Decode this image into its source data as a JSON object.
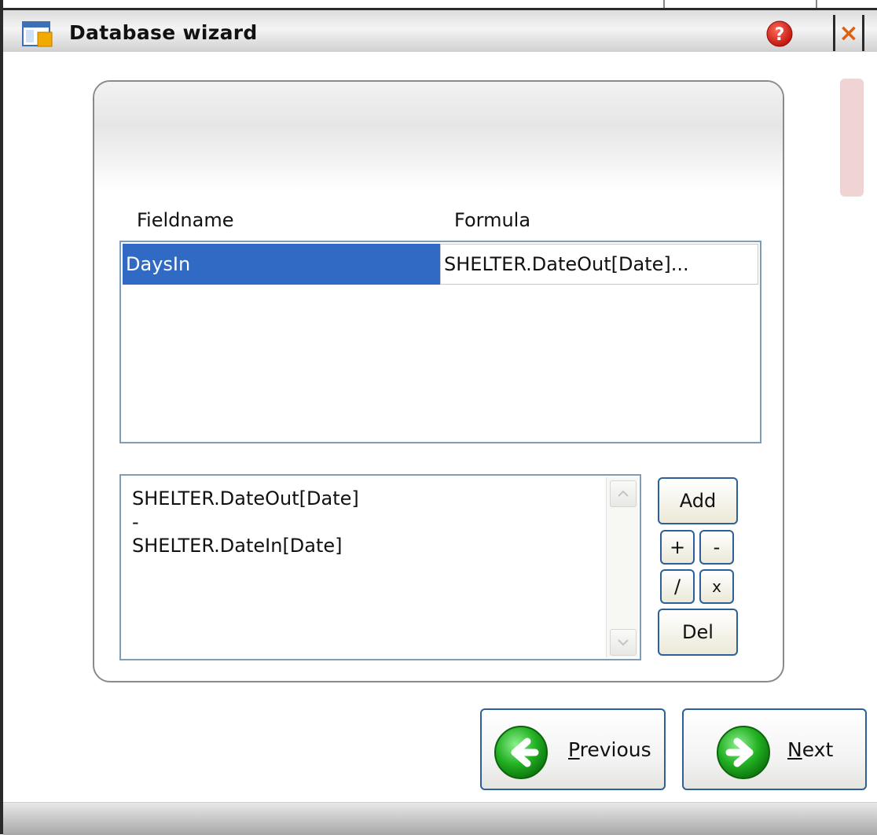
{
  "window": {
    "title": "Database wizard",
    "help_icon": "help-icon",
    "close_icon": "close-icon",
    "close_glyph": "×"
  },
  "grid": {
    "columns": [
      "Fieldname",
      "Formula"
    ],
    "rows": [
      {
        "fieldname": "DaysIn",
        "formula": "SHELTER.DateOut[Date]..."
      }
    ],
    "selection_color": "#316ac5"
  },
  "editor": {
    "lines": [
      "SHELTER.DateOut[Date]",
      "-",
      "SHELTER.DateIn[Date]"
    ]
  },
  "operators": {
    "add": "Add",
    "plus": "+",
    "minus": "-",
    "divide": "/",
    "multiply": "x",
    "del": "Del"
  },
  "navigation": {
    "previous_label": "Previous",
    "previous_accesskey": "P",
    "previous_rest": "revious",
    "next_label": "Next",
    "next_accesskey": "N",
    "next_rest": "ext"
  },
  "colors": {
    "accent_border": "#2d5f9a",
    "nav_icon_green": "#1fa31f"
  }
}
